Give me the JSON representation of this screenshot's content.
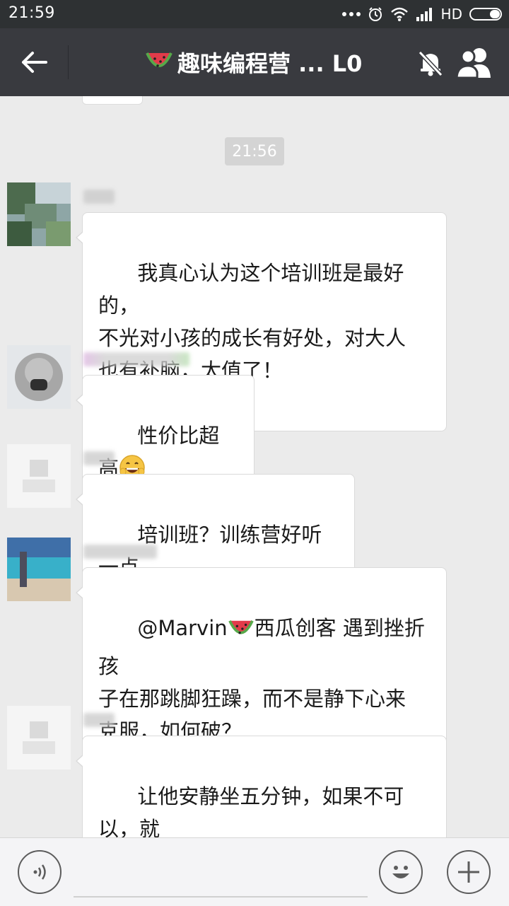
{
  "status_bar": {
    "time": "21:59",
    "network_label": "HD",
    "icons": [
      "more-dots-icon",
      "alarm-icon",
      "wifi-icon",
      "signal-icon",
      "battery-icon"
    ]
  },
  "header": {
    "title": "趣味编程营 ... L0",
    "title_icon": "watermelon-emoji",
    "back_icon": "arrow-left-icon",
    "mute_icon": "bell-muted-icon",
    "members_icon": "group-members-icon",
    "bar_color": "#393a3f"
  },
  "chat": {
    "timestamp": "21:56",
    "messages": [
      {
        "text": "我真心认为这个培训班是最好的，\n不光对小孩的成长有好处，对大人\n也有补脑，太值了！"
      },
      {
        "text": "性价比超高",
        "trailing_icon": "grinning-emoji"
      },
      {
        "text": "培训班？训练营好听一点"
      },
      {
        "text_before": "@Marvin",
        "inline_icon": "watermelon-emoji",
        "text_after": "西瓜创客 遇到挫折孩\n子在那跳脚狂躁，而不是静下心来\n克服，如何破？"
      },
      {
        "text": "让他安静坐五分钟，如果不可以，就\n取消....（他最爱的）"
      }
    ]
  },
  "input_bar": {
    "voice_icon": "voice-icon",
    "emoji_icon": "smiley-icon",
    "plus_icon": "plus-icon",
    "placeholder": ""
  }
}
